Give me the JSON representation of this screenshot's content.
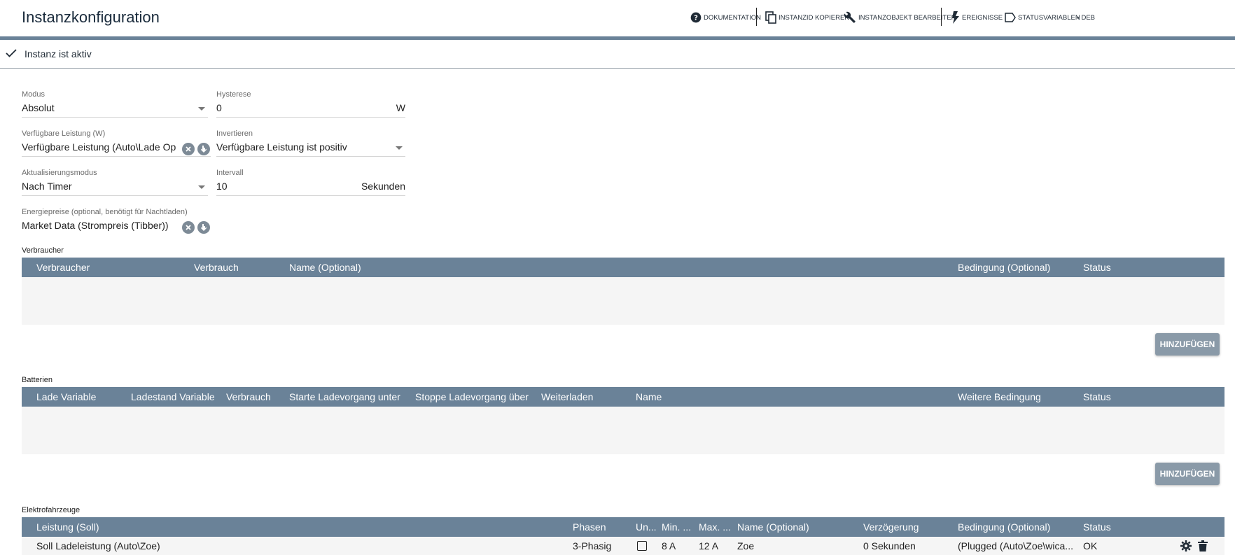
{
  "header": {
    "title": "Instanzkonfiguration",
    "toolbar": [
      {
        "label": "Dokumentation",
        "icon": "help-circle-icon"
      },
      {
        "label": "InstanzID kopieren",
        "icon": "copy-icon"
      },
      {
        "label": "Instanzobjekt bearbeiten",
        "icon": "wrench-icon"
      },
      {
        "label": "Ereignisse",
        "icon": "lightning-icon"
      },
      {
        "label": "Statusvariablen",
        "icon": "tag-icon"
      },
      {
        "label": "Deb",
        "icon": "bug-icon"
      }
    ]
  },
  "status": {
    "text": "Instanz ist aktiv"
  },
  "form": {
    "modus": {
      "label": "Modus",
      "value": "Absolut"
    },
    "hysterese": {
      "label": "Hysterese",
      "value": "0",
      "suffix": "W"
    },
    "leistung": {
      "label": "Verfügbare Leistung (W)",
      "value": "Verfügbare Leistung (Auto\\Lade Op"
    },
    "invertieren": {
      "label": "Invertieren",
      "value": "Verfügbare Leistung ist positiv"
    },
    "aktualisierung": {
      "label": "Aktualisierungsmodus",
      "value": "Nach Timer"
    },
    "intervall": {
      "label": "Intervall",
      "value": "10",
      "suffix": "Sekunden"
    },
    "energiepreise": {
      "label": "Energiepreise (optional, benötigt für Nachtladen)",
      "value": "Market Data (Strompreis (Tibber))"
    }
  },
  "verbraucher": {
    "label": "Verbraucher",
    "columns": [
      "Verbraucher",
      "Verbrauch",
      "Name (Optional)",
      "Bedingung (Optional)",
      "Status"
    ],
    "add_label": "HINZUFÜGEN"
  },
  "batterien": {
    "label": "Batterien",
    "columns": [
      "Lade Variable",
      "Ladestand Variable",
      "Verbrauch",
      "Starte Ladevorgang unter",
      "Stoppe Ladevorgang über",
      "Weiterladen",
      "Name",
      "Weitere Bedingung",
      "Status"
    ],
    "add_label": "HINZUFÜGEN"
  },
  "elektrofahrzeuge": {
    "label": "Elektrofahrzeuge",
    "columns": [
      "Leistung (Soll)",
      "Phasen",
      "Un...",
      "Min. ...",
      "Max. ...",
      "Name (Optional)",
      "Verzögerung",
      "Bedingung (Optional)",
      "Status"
    ],
    "rows": [
      {
        "leistung": "Soll Ladeleistung (Auto\\Zoe)",
        "phasen": "3-Phasig",
        "min": "8 A",
        "max": "12 A",
        "name": "Zoe",
        "verzoegerung": "0 Sekunden",
        "bedingung": "(Plugged (Auto\\Zoe\\wica...",
        "status": "OK"
      }
    ]
  },
  "colors": {
    "accent": "#6a8298",
    "button": "#8a9aa8",
    "row_bg": "#f5f5f5"
  }
}
